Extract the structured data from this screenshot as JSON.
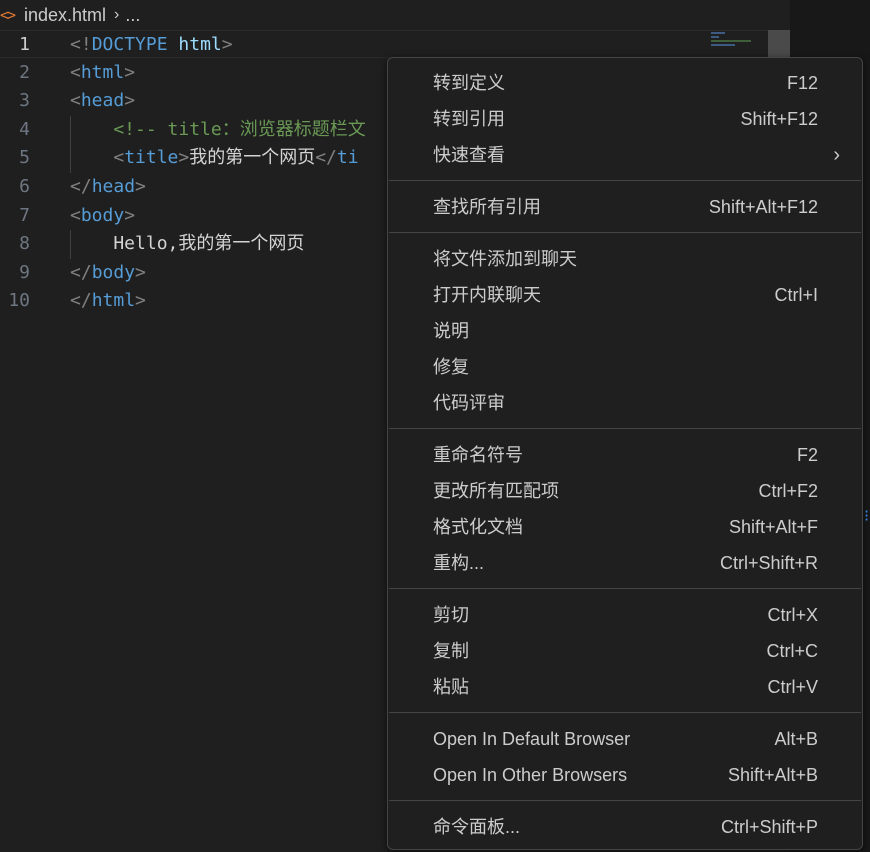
{
  "breadcrumb": {
    "icon": "<>",
    "file": "index.html",
    "separator": "›",
    "more": "..."
  },
  "editor": {
    "line_numbers": [
      "1",
      "2",
      "3",
      "4",
      "5",
      "6",
      "7",
      "8",
      "9",
      "10"
    ],
    "lines": [
      [
        {
          "t": "<!",
          "c": "punct"
        },
        {
          "t": "DOCTYPE ",
          "c": "tag"
        },
        {
          "t": "html",
          "c": "attr"
        },
        {
          "t": ">",
          "c": "punct"
        }
      ],
      [
        {
          "t": "<",
          "c": "punct"
        },
        {
          "t": "html",
          "c": "tag"
        },
        {
          "t": ">",
          "c": "punct"
        }
      ],
      [
        {
          "t": "<",
          "c": "punct"
        },
        {
          "t": "head",
          "c": "tag"
        },
        {
          "t": ">",
          "c": "punct"
        }
      ],
      [
        {
          "t": "    <!-- title：浏览器标题栏文",
          "c": "comment"
        }
      ],
      [
        {
          "t": "    <",
          "c": "punct"
        },
        {
          "t": "title",
          "c": "tag"
        },
        {
          "t": ">",
          "c": "punct"
        },
        {
          "t": "我的第一个网页",
          "c": "text"
        },
        {
          "t": "</",
          "c": "punct"
        },
        {
          "t": "ti",
          "c": "tag"
        }
      ],
      [
        {
          "t": "</",
          "c": "punct"
        },
        {
          "t": "head",
          "c": "tag"
        },
        {
          "t": ">",
          "c": "punct"
        }
      ],
      [
        {
          "t": "<",
          "c": "punct"
        },
        {
          "t": "body",
          "c": "tag"
        },
        {
          "t": ">",
          "c": "punct"
        }
      ],
      [
        {
          "t": "    Hello,我的第一个网页",
          "c": "text"
        }
      ],
      [
        {
          "t": "</",
          "c": "punct"
        },
        {
          "t": "body",
          "c": "tag"
        },
        {
          "t": ">",
          "c": "punct"
        }
      ],
      [
        {
          "t": "</",
          "c": "punct"
        },
        {
          "t": "html",
          "c": "tag"
        },
        {
          "t": ">",
          "c": "punct"
        }
      ]
    ]
  },
  "context_menu": {
    "groups": [
      [
        {
          "label": "转到定义",
          "key": "F12"
        },
        {
          "label": "转到引用",
          "key": "Shift+F12"
        },
        {
          "label": "快速查看",
          "key": "",
          "submenu": true
        }
      ],
      [
        {
          "label": "查找所有引用",
          "key": "Shift+Alt+F12"
        }
      ],
      [
        {
          "label": "将文件添加到聊天",
          "key": ""
        },
        {
          "label": "打开内联聊天",
          "key": "Ctrl+I"
        },
        {
          "label": "说明",
          "key": ""
        },
        {
          "label": "修复",
          "key": ""
        },
        {
          "label": "代码评审",
          "key": ""
        }
      ],
      [
        {
          "label": "重命名符号",
          "key": "F2"
        },
        {
          "label": "更改所有匹配项",
          "key": "Ctrl+F2"
        },
        {
          "label": "格式化文档",
          "key": "Shift+Alt+F"
        },
        {
          "label": "重构...",
          "key": "Ctrl+Shift+R"
        }
      ],
      [
        {
          "label": "剪切",
          "key": "Ctrl+X"
        },
        {
          "label": "复制",
          "key": "Ctrl+C"
        },
        {
          "label": "粘贴",
          "key": "Ctrl+V"
        }
      ],
      [
        {
          "label": "Open In Default Browser",
          "key": "Alt+B"
        },
        {
          "label": "Open In Other Browsers",
          "key": "Shift+Alt+B"
        }
      ],
      [
        {
          "label": "命令面板...",
          "key": "Ctrl+Shift+P"
        }
      ]
    ],
    "submenu_arrow": "›"
  },
  "colors": {
    "background": "#1f1f1f",
    "tag": "#569cd6",
    "comment": "#6a9955",
    "attr": "#9cdcfe",
    "file_icon": "#e37933"
  }
}
